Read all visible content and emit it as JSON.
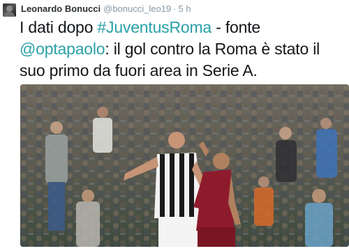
{
  "tweet": {
    "author": {
      "display_name": "Leonardo Bonucci",
      "handle": "@bonucci_leo19",
      "separator": "·",
      "timestamp": "5 h"
    },
    "text": {
      "part1": "I dati dopo ",
      "hashtag": "#JuventusRoma",
      "part2": " - fonte ",
      "mention": "@optapaolo",
      "part3": ": il gol contro la Roma è stato il suo primo da fuori area in Serie A."
    },
    "colors": {
      "link": "#2ba1a8",
      "meta": "#8899a6",
      "text": "#14171a"
    },
    "media": {
      "icon": "photo"
    }
  }
}
